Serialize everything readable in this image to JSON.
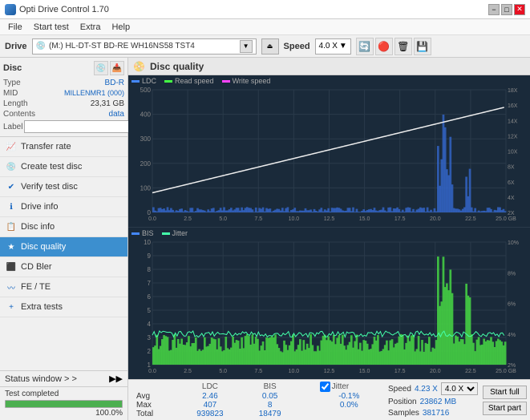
{
  "app": {
    "title": "Opti Drive Control 1.70",
    "icon": "opti-icon"
  },
  "titlebar": {
    "title": "Opti Drive Control 1.70",
    "minimize_label": "−",
    "maximize_label": "□",
    "close_label": "✕"
  },
  "menubar": {
    "items": [
      {
        "label": "File",
        "id": "file"
      },
      {
        "label": "Start test",
        "id": "start-test"
      },
      {
        "label": "Extra",
        "id": "extra"
      },
      {
        "label": "Help",
        "id": "help"
      }
    ]
  },
  "drivebar": {
    "drive_label": "Drive",
    "drive_value": "(M:)  HL-DT-ST BD-RE  WH16NS58 TST4",
    "speed_label": "Speed",
    "speed_value": "4.0 X",
    "eject_symbol": "⏏"
  },
  "disc": {
    "title": "Disc",
    "type_label": "Type",
    "type_value": "BD-R",
    "mid_label": "MID",
    "mid_value": "MILLENMR1 (000)",
    "length_label": "Length",
    "length_value": "23,31 GB",
    "contents_label": "Contents",
    "contents_value": "data",
    "label_label": "Label",
    "label_value": "",
    "label_placeholder": ""
  },
  "nav": {
    "items": [
      {
        "id": "transfer-rate",
        "label": "Transfer rate",
        "icon": "📈"
      },
      {
        "id": "create-test-disc",
        "label": "Create test disc",
        "icon": "💿"
      },
      {
        "id": "verify-test-disc",
        "label": "Verify test disc",
        "icon": "✔"
      },
      {
        "id": "drive-info",
        "label": "Drive info",
        "icon": "ℹ"
      },
      {
        "id": "disc-info",
        "label": "Disc info",
        "icon": "📋"
      },
      {
        "id": "disc-quality",
        "label": "Disc quality",
        "icon": "★",
        "active": true
      },
      {
        "id": "cd-bler",
        "label": "CD Bler",
        "icon": "⬛"
      },
      {
        "id": "fe-te",
        "label": "FE / TE",
        "icon": "〰"
      },
      {
        "id": "extra-tests",
        "label": "Extra tests",
        "icon": "+"
      }
    ]
  },
  "status": {
    "window_label": "Status window > >",
    "completed_text": "Test completed",
    "progress_percent": 100
  },
  "disc_quality": {
    "title": "Disc quality",
    "legend": {
      "ldc_label": "LDC",
      "read_label": "Read speed",
      "write_label": "Write speed",
      "bis_label": "BIS",
      "jitter_label": "Jitter"
    },
    "chart_top": {
      "y_max": 500,
      "y_right_max": 18,
      "x_max": 25,
      "y_labels": [
        "500",
        "400",
        "300",
        "200",
        "100"
      ],
      "y_right_labels": [
        "18X",
        "16X",
        "14X",
        "12X",
        "10X",
        "8X",
        "6X",
        "4X",
        "2X"
      ],
      "x_labels": [
        "0.0",
        "2.5",
        "5.0",
        "7.5",
        "10.0",
        "12.5",
        "15.0",
        "17.5",
        "20.0",
        "22.5",
        "25.0 GB"
      ]
    },
    "chart_bottom": {
      "y_max": 10,
      "y_right_max": 10,
      "x_max": 25,
      "y_labels": [
        "10",
        "9",
        "8",
        "7",
        "6",
        "5",
        "4",
        "3",
        "2",
        "1"
      ],
      "y_right_labels": [
        "10%",
        "8%",
        "6%",
        "4%",
        "2%"
      ],
      "x_labels": [
        "0.0",
        "2.5",
        "5.0",
        "7.5",
        "10.0",
        "12.5",
        "15.0",
        "17.5",
        "20.0",
        "22.5",
        "25.0 GB"
      ]
    },
    "stats": {
      "col_headers": [
        "LDC",
        "BIS",
        "",
        "Jitter",
        "Speed"
      ],
      "avg_label": "Avg",
      "avg_ldc": "2.46",
      "avg_bis": "0.05",
      "avg_jitter": "-0.1%",
      "max_label": "Max",
      "max_ldc": "407",
      "max_bis": "8",
      "max_jitter": "0.0%",
      "total_label": "Total",
      "total_ldc": "939823",
      "total_bis": "18479",
      "speed_avg": "4.23 X",
      "speed_select": "4.0 X",
      "position_label": "Position",
      "position_value": "23862 MB",
      "samples_label": "Samples",
      "samples_value": "381716",
      "jitter_checked": true,
      "jitter_label": "Jitter",
      "start_full_label": "Start full",
      "start_part_label": "Start part"
    }
  },
  "colors": {
    "accent_blue": "#1565c0",
    "chart_bg": "#1a2a3a",
    "chart_grid": "#2a3a4a",
    "ldc_color": "#4488ff",
    "read_color": "#44ff44",
    "write_color": "#ff44ff",
    "bis_color": "#4488ff",
    "jitter_color": "#44ffaa",
    "spike_color": "#44ff44",
    "active_nav": "#3c8fcf"
  }
}
